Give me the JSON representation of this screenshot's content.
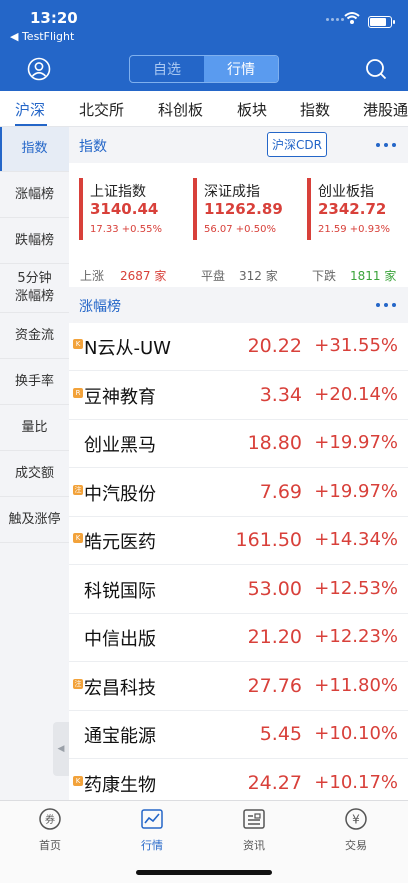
{
  "status": {
    "time": "13:20",
    "back_app": "◀ TestFlight"
  },
  "header": {
    "segments": [
      "自选",
      "行情"
    ],
    "active_segment": "行情"
  },
  "market_tabs": [
    "沪深",
    "北交所",
    "科创板",
    "板块",
    "指数",
    "港股通"
  ],
  "side_nav": [
    {
      "label": "指数",
      "active": true
    },
    {
      "label": "涨幅榜",
      "active": false
    },
    {
      "label": "跌幅榜",
      "active": false
    },
    {
      "label": "5分钟\n涨幅榜",
      "active": false
    },
    {
      "label": "资金流",
      "active": false
    },
    {
      "label": "换手率",
      "active": false
    },
    {
      "label": "量比",
      "active": false
    },
    {
      "label": "成交额",
      "active": false
    },
    {
      "label": "触及涨停",
      "active": false
    }
  ],
  "index_section": {
    "title": "指数",
    "cdr_button": "沪深CDR",
    "cards": [
      {
        "name": "上证指数",
        "value": "3140.44",
        "change": "17.33 +0.55%"
      },
      {
        "name": "深证成指",
        "value": "11262.89",
        "change": "56.07 +0.50%"
      },
      {
        "name": "创业板指",
        "value": "2342.72",
        "change": "21.59 +0.93%"
      }
    ],
    "breadth": {
      "up_label": "上涨",
      "up_count": "2687 家",
      "flat_label": "平盘",
      "flat_count": "312 家",
      "down_label": "下跌",
      "down_count": "1811 家"
    }
  },
  "gainers_section": {
    "title": "涨幅榜",
    "stocks": [
      {
        "badge": "K",
        "name": "N云从-UW",
        "price": "20.22",
        "change": "+31.55%"
      },
      {
        "badge": "R",
        "name": "豆神教育",
        "price": "3.34",
        "change": "+20.14%"
      },
      {
        "badge": "",
        "name": "创业黑马",
        "price": "18.80",
        "change": "+19.97%"
      },
      {
        "badge": "注",
        "name": "中汽股份",
        "price": "7.69",
        "change": "+19.97%"
      },
      {
        "badge": "K",
        "name": "皓元医药",
        "price": "161.50",
        "change": "+14.34%"
      },
      {
        "badge": "",
        "name": "科锐国际",
        "price": "53.00",
        "change": "+12.53%"
      },
      {
        "badge": "",
        "name": "中信出版",
        "price": "21.20",
        "change": "+12.23%"
      },
      {
        "badge": "注",
        "name": "宏昌科技",
        "price": "27.76",
        "change": "+11.80%"
      },
      {
        "badge": "",
        "name": "通宝能源",
        "price": "5.45",
        "change": "+10.10%"
      },
      {
        "badge": "K",
        "name": "药康生物",
        "price": "24.27",
        "change": "+10.17%"
      }
    ]
  },
  "tabbar": [
    {
      "label": "首页",
      "icon": "home-coin-icon",
      "active": false
    },
    {
      "label": "行情",
      "icon": "chart-icon",
      "active": true
    },
    {
      "label": "资讯",
      "icon": "news-icon",
      "active": false
    },
    {
      "label": "交易",
      "icon": "trade-yen-icon",
      "active": false
    }
  ],
  "colors": {
    "brand": "#2466c8",
    "up": "#d8403a",
    "down": "#3aa33a"
  }
}
